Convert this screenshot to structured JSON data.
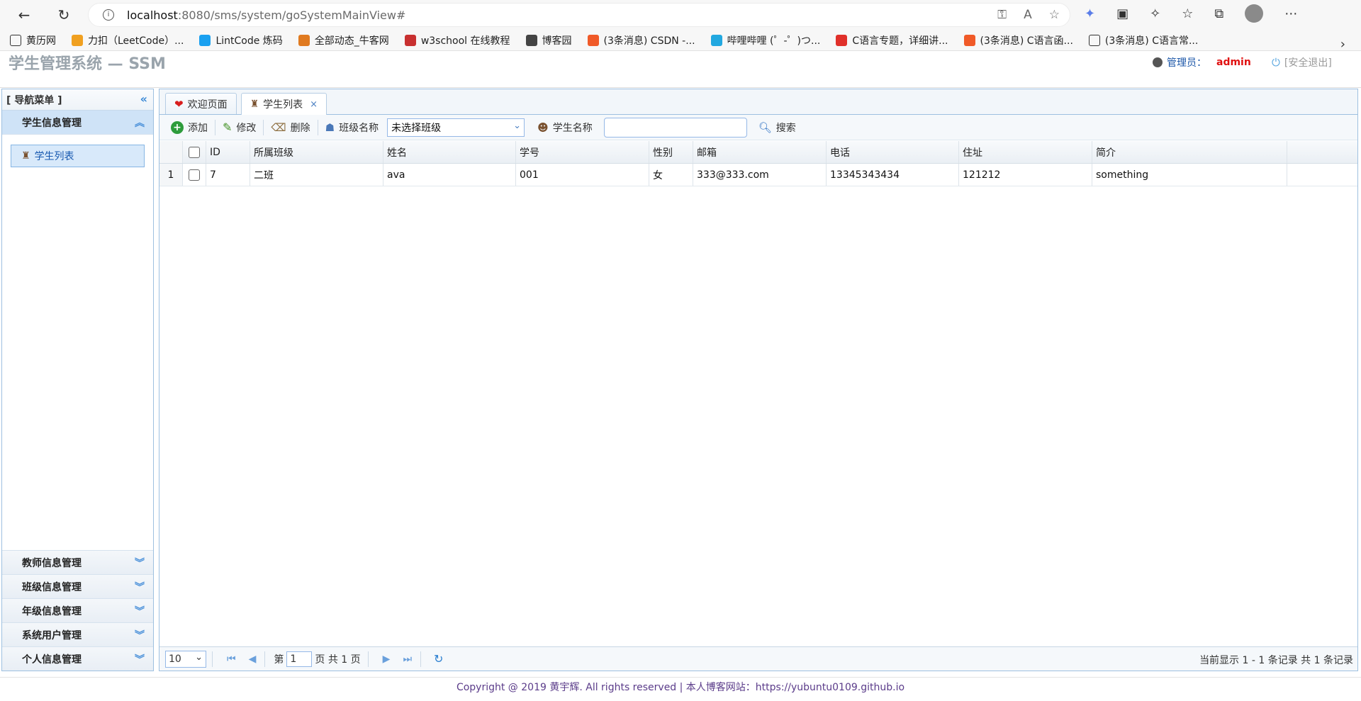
{
  "browser": {
    "url_host": "localhost",
    "url_path": ":8080/sms/system/goSystemMainView#",
    "bookmarks": [
      {
        "label": "黄历网",
        "color": "#ffffff"
      },
      {
        "label": "力扣（LeetCode）...",
        "color": "#f0a020"
      },
      {
        "label": "LintCode 炼码",
        "color": "#1aa0f0"
      },
      {
        "label": "全部动态_牛客网",
        "color": "#e07a20"
      },
      {
        "label": "w3school 在线教程",
        "color": "#c83030"
      },
      {
        "label": "博客园",
        "color": "#444444"
      },
      {
        "label": "(3条消息) CSDN -...",
        "color": "#f05a28"
      },
      {
        "label": "哔哩哔哩 (゜-゜)つ...",
        "color": "#22a8e0"
      },
      {
        "label": "C语言专题，详细讲...",
        "color": "#e0302a"
      },
      {
        "label": "(3条消息) C语言函...",
        "color": "#f05a28"
      },
      {
        "label": "(3条消息) C语言常...",
        "color": "#ffffff"
      }
    ]
  },
  "app": {
    "title": "学生管理系统 — SSM",
    "admin_label": "管理员：",
    "admin_name": "admin",
    "logout": "[安全退出]"
  },
  "sidebar": {
    "header": "[ 导航菜单 ]",
    "active_section": "学生信息管理",
    "active_item": "学生列表",
    "sections": [
      "教师信息管理",
      "班级信息管理",
      "年级信息管理",
      "系统用户管理",
      "个人信息管理"
    ]
  },
  "tabs": [
    {
      "label": "欢迎页面"
    },
    {
      "label": "学生列表"
    }
  ],
  "toolbar": {
    "add": "添加",
    "edit": "修改",
    "delete": "删除",
    "class_label": "班级名称",
    "class_select": "未选择班级",
    "student_label": "学生名称",
    "search": "搜索"
  },
  "grid": {
    "columns": [
      "ID",
      "所属班级",
      "姓名",
      "学号",
      "性别",
      "邮箱",
      "电话",
      "住址",
      "简介"
    ],
    "rows": [
      {
        "num": "1",
        "id": "7",
        "class": "二班",
        "name": "ava",
        "sno": "001",
        "gender": "女",
        "email": "333@333.com",
        "phone": "13345343434",
        "address": "121212",
        "intro": "something"
      }
    ]
  },
  "pager": {
    "page_size": "10",
    "page_prefix": "第",
    "page_value": "1",
    "page_suffix": "页 共 1 页",
    "info": "当前显示 1 - 1 条记录 共 1 条记录"
  },
  "footer": "Copyright @ 2019 黄宇辉. All rights reserved | 本人博客网站：https://yubuntu0109.github.io"
}
